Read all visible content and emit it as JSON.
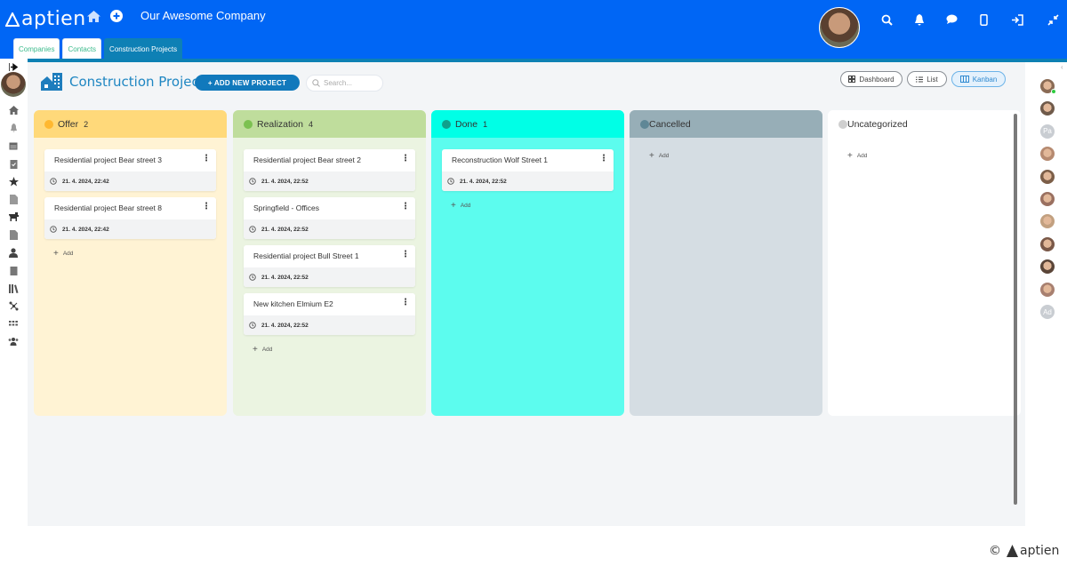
{
  "app": {
    "logo_text": "aptien",
    "company_name": "Our Awesome Company",
    "brand_color": "#0066f5"
  },
  "topbar": {
    "icons": [
      "home-icon",
      "add-circle-icon",
      "search-icon",
      "bell-icon",
      "chat-icon",
      "mobile-icon",
      "sign-in-icon",
      "collapse-icon"
    ]
  },
  "tabs": [
    {
      "label": "Companies",
      "active": false
    },
    {
      "label": "Contacts",
      "active": false
    },
    {
      "label": "Construction Projects",
      "active": true
    }
  ],
  "left_nav": {
    "items": [
      "expand-arrow-icon",
      "home-icon",
      "bell-icon",
      "calendar-icon",
      "clipboard-check-icon",
      "star-icon",
      "document-icon",
      "dog-icon",
      "file-image-icon",
      "user-icon",
      "clipboard-icon",
      "books-icon",
      "network-icon",
      "grid-icon",
      "team-icon"
    ]
  },
  "page": {
    "title": "Construction Projects",
    "add_button_label": "+ ADD NEW PROJECT",
    "search_placeholder": "Search...",
    "views": [
      {
        "label": "Dashboard",
        "icon": "dashboard-icon",
        "active": false
      },
      {
        "label": "List",
        "icon": "list-icon",
        "active": false
      },
      {
        "label": "Kanban",
        "icon": "kanban-icon",
        "active": true
      }
    ]
  },
  "board": {
    "add_label": "Add",
    "columns": [
      {
        "title": "Offer",
        "count": "2",
        "head_color": "#ffd97a",
        "body_color": "#fff3d4",
        "dot_color": "#ffb830",
        "cards": [
          {
            "title": "Residential project Bear street 3",
            "date": "21. 4. 2024, 22:42"
          },
          {
            "title": "Residential project Bear street 8",
            "date": "21. 4. 2024, 22:42"
          }
        ]
      },
      {
        "title": "Realization",
        "count": "4",
        "head_color": "#bfdd9c",
        "body_color": "#ebf4e1",
        "dot_color": "#7cc151",
        "cards": [
          {
            "title": "Residential project Bear street 2",
            "date": "21. 4. 2024, 22:52"
          },
          {
            "title": "Springfield - Offices",
            "date": "21. 4. 2024, 22:52"
          },
          {
            "title": "Residential project Bull Street 1",
            "date": "21. 4. 2024, 22:52"
          },
          {
            "title": "New kitchen Elmium E2",
            "date": "21. 4. 2024, 22:52"
          }
        ]
      },
      {
        "title": "Done",
        "count": "1",
        "head_color": "#00ffe6",
        "body_color": "#5cfcee",
        "dot_color": "#10a08c",
        "cards": [
          {
            "title": "Reconstruction Wolf Street 1",
            "date": "21. 4. 2024, 22:52"
          }
        ]
      },
      {
        "title": "Cancelled",
        "count": "",
        "head_color": "#97aeb7",
        "body_color": "#d5dde3",
        "dot_color": "#5f8796",
        "cards": []
      },
      {
        "title": "Uncategorized",
        "count": "",
        "head_color": "#ffffff",
        "body_color": "#ffffff",
        "dot_color": "#cfcfcf",
        "cards": []
      }
    ]
  },
  "right_bar": {
    "users": [
      {
        "initials": "",
        "online": true
      },
      {
        "initials": "",
        "online": false
      },
      {
        "initials": "Pa",
        "online": false
      },
      {
        "initials": "",
        "online": false
      },
      {
        "initials": "",
        "online": false
      },
      {
        "initials": "",
        "online": false
      },
      {
        "initials": "",
        "online": false
      },
      {
        "initials": "",
        "online": false
      },
      {
        "initials": "",
        "online": false
      },
      {
        "initials": "",
        "online": false
      },
      {
        "initials": "Ad",
        "online": false
      }
    ]
  },
  "footer": {
    "copyright": "©",
    "logo_text": "aptien"
  }
}
